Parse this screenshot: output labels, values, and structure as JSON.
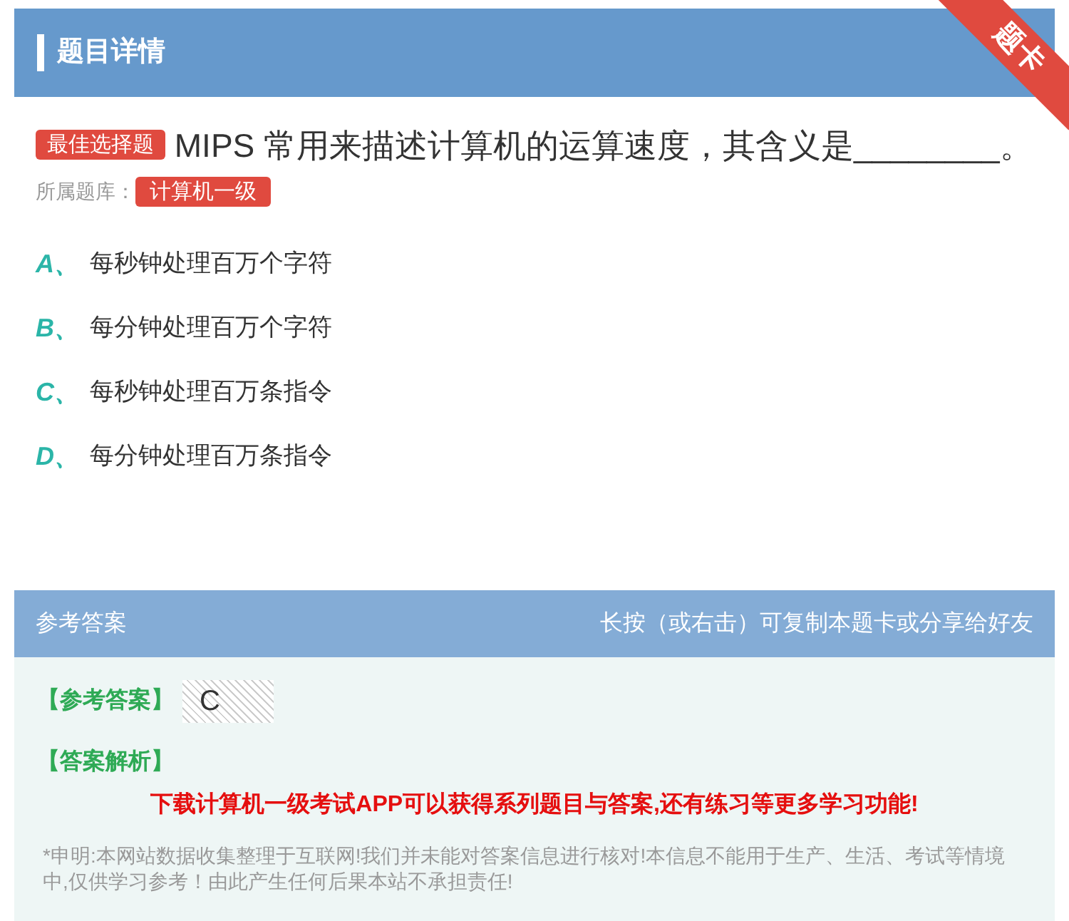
{
  "header": {
    "title": "题目详情",
    "ribbon": "题卡"
  },
  "question": {
    "type_tag": "最佳选择题",
    "text": "MIPS 常用来描述计算机的运算速度，其含义是________。",
    "bank_label": "所属题库：",
    "bank": "计算机一级"
  },
  "options": [
    {
      "letter": "A、",
      "text": "每秒钟处理百万个字符"
    },
    {
      "letter": "B、",
      "text": "每分钟处理百万个字符"
    },
    {
      "letter": "C、",
      "text": "每秒钟处理百万条指令"
    },
    {
      "letter": "D、",
      "text": "每分钟处理百万条指令"
    }
  ],
  "answer_panel": {
    "title": "参考答案",
    "hint": "长按（或右击）可复制本题卡或分享给好友",
    "answer_label": "【参考答案】",
    "answer": "C",
    "analysis_label": "【答案解析】",
    "promo": "下载计算机一级考试APP可以获得系列题目与答案,还有练习等更多学习功能!",
    "disclaimer": "*申明:本网站数据收集整理于互联网!我们并未能对答案信息进行核对!本信息不能用于生产、生活、考试等情境中,仅供学习参考！由此产生任何后果本站不承担责任!"
  }
}
